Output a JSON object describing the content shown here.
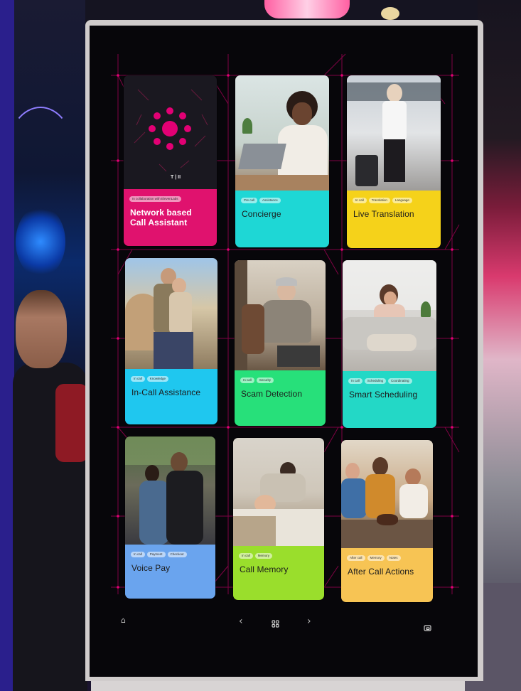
{
  "cards": [
    {
      "id": "network",
      "tags": [
        "In collaboration with ElevenLabs"
      ],
      "title": "Network based\nCall Assistant",
      "panel_color": "#e0126e",
      "logo": "T | II",
      "icon": "telekom-dots-logo"
    },
    {
      "id": "concierge",
      "tags": [
        "Pre call",
        "Assistance"
      ],
      "title": "Concierge",
      "panel_color": "#1ed7d5"
    },
    {
      "id": "translation",
      "tags": [
        "In call",
        "Translation",
        "Language"
      ],
      "title": "Live Translation",
      "panel_color": "#f5d21a"
    },
    {
      "id": "incall",
      "tags": [
        "In call",
        "Knowledge"
      ],
      "title": "In-Call Assistance",
      "panel_color": "#1fc7ef"
    },
    {
      "id": "scam",
      "tags": [
        "In call",
        "Security"
      ],
      "title": "Scam Detection",
      "panel_color": "#27e07a"
    },
    {
      "id": "scheduling",
      "tags": [
        "In call",
        "Scheduling",
        "Coordinating"
      ],
      "title": "Smart Scheduling",
      "panel_color": "#23d8c6"
    },
    {
      "id": "voicepay",
      "tags": [
        "In call",
        "Payment",
        "Checkout"
      ],
      "title": "Voice Pay",
      "panel_color": "#6aa4ee"
    },
    {
      "id": "memory",
      "tags": [
        "In call",
        "Memory"
      ],
      "title": "Call Memory",
      "panel_color": "#9ade2c"
    },
    {
      "id": "aftercall",
      "tags": [
        "After call",
        "Memory",
        "Notes"
      ],
      "title": "After Call Actions",
      "panel_color": "#f7c454"
    }
  ],
  "nav": {
    "home_icon": "home-icon",
    "prev_icon": "chevron-left-icon",
    "grid_icon": "grid-icon",
    "next_icon": "chevron-right-icon",
    "cast_icon": "cast-icon"
  },
  "colors": {
    "accent": "#e20074",
    "screen": "#07060a"
  }
}
